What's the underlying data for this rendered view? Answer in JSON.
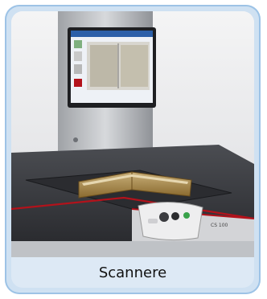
{
  "card": {
    "caption": "Scannere"
  },
  "device": {
    "model_badge": "CS 100"
  },
  "colors": {
    "card_border": "#9dc3e6",
    "card_bg": "#cfe1f2",
    "caption_text": "#111111",
    "scanner_body": "#3a3b3f",
    "scanner_accent": "#b3121b"
  },
  "icons": {
    "monitor": "monitor-icon",
    "book": "open-book-icon",
    "control_panel": "control-panel-icon"
  }
}
